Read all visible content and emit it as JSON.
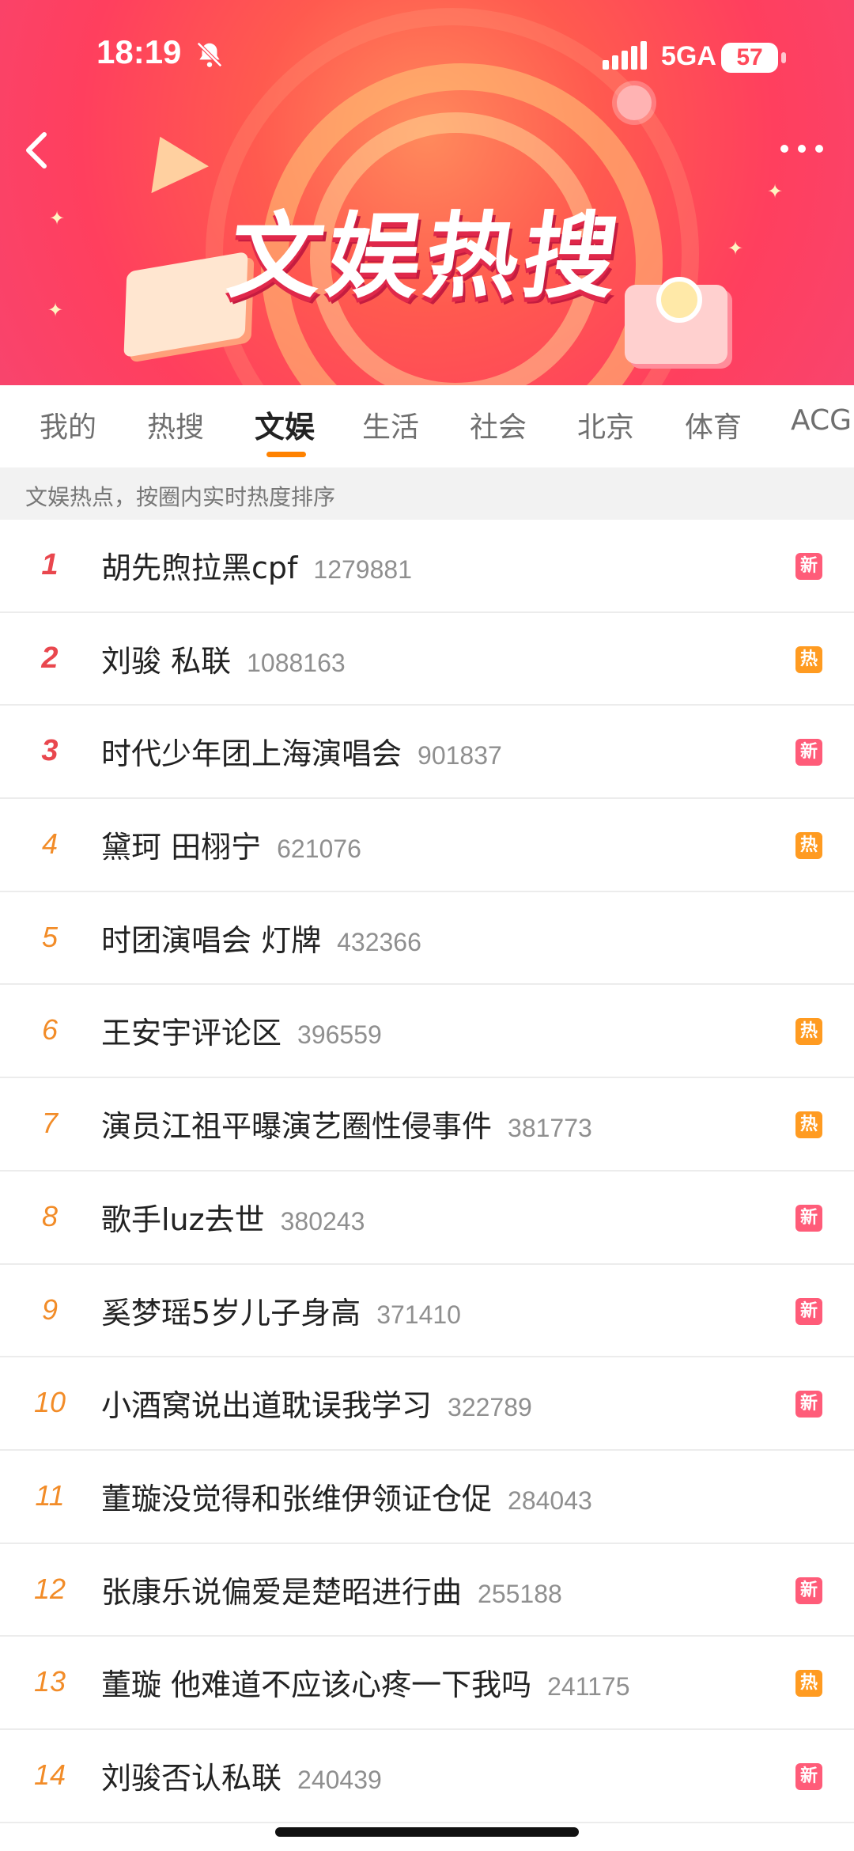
{
  "status_bar": {
    "time": "18:19",
    "network": "5GA",
    "battery": "57"
  },
  "banner": {
    "title": "文娱热搜"
  },
  "tabs": [
    {
      "label": "我的",
      "active": false
    },
    {
      "label": "热搜",
      "active": false
    },
    {
      "label": "文娱",
      "active": true
    },
    {
      "label": "生活",
      "active": false
    },
    {
      "label": "社会",
      "active": false
    },
    {
      "label": "北京",
      "active": false
    },
    {
      "label": "体育",
      "active": false
    },
    {
      "label": "ACG",
      "active": false
    }
  ],
  "subtitle": "文娱热点，按圈内实时热度排序",
  "colors": {
    "accent": "#ff8200",
    "rank_top": "#e9474e",
    "rank": "#f28c28",
    "badge_new": "#ff5c79",
    "badge_hot": "#ff9b21"
  },
  "items": [
    {
      "rank": "1",
      "title": "胡先煦拉黑cpf",
      "count": "1279881",
      "badge": "新",
      "badge_type": "new"
    },
    {
      "rank": "2",
      "title": "刘骏 私联",
      "count": "1088163",
      "badge": "热",
      "badge_type": "hot"
    },
    {
      "rank": "3",
      "title": "时代少年团上海演唱会",
      "count": "901837",
      "badge": "新",
      "badge_type": "new"
    },
    {
      "rank": "4",
      "title": "黛珂 田栩宁",
      "count": "621076",
      "badge": "热",
      "badge_type": "hot"
    },
    {
      "rank": "5",
      "title": "时团演唱会 灯牌",
      "count": "432366",
      "badge": "",
      "badge_type": ""
    },
    {
      "rank": "6",
      "title": "王安宇评论区",
      "count": "396559",
      "badge": "热",
      "badge_type": "hot"
    },
    {
      "rank": "7",
      "title": "演员江祖平曝演艺圈性侵事件",
      "count": "381773",
      "badge": "热",
      "badge_type": "hot"
    },
    {
      "rank": "8",
      "title": "歌手luz去世",
      "count": "380243",
      "badge": "新",
      "badge_type": "new"
    },
    {
      "rank": "9",
      "title": "奚梦瑶5岁儿子身高",
      "count": "371410",
      "badge": "新",
      "badge_type": "new"
    },
    {
      "rank": "10",
      "title": "小酒窝说出道耽误我学习",
      "count": "322789",
      "badge": "新",
      "badge_type": "new"
    },
    {
      "rank": "11",
      "title": "董璇没觉得和张维伊领证仓促",
      "count": "284043",
      "badge": "",
      "badge_type": ""
    },
    {
      "rank": "12",
      "title": "张康乐说偏爱是楚昭进行曲",
      "count": "255188",
      "badge": "新",
      "badge_type": "new"
    },
    {
      "rank": "13",
      "title": "董璇 他难道不应该心疼一下我吗",
      "count": "241175",
      "badge": "热",
      "badge_type": "hot"
    },
    {
      "rank": "14",
      "title": "刘骏否认私联",
      "count": "240439",
      "badge": "新",
      "badge_type": "new"
    }
  ]
}
